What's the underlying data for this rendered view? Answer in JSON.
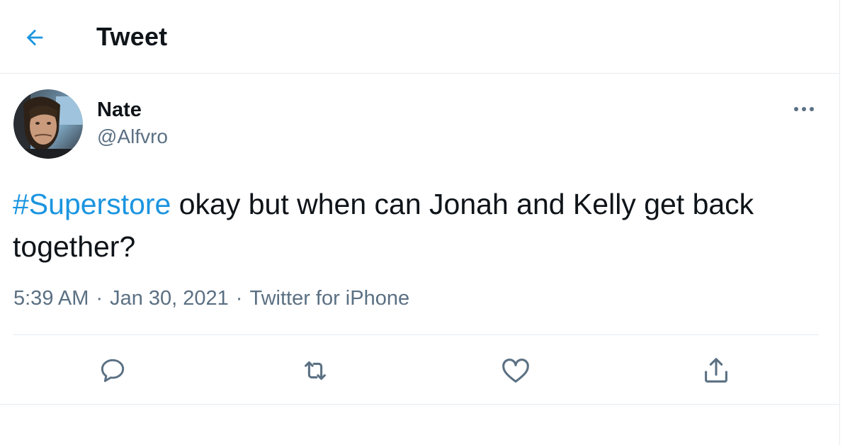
{
  "header": {
    "back_icon": "arrow-left-icon",
    "title": "Tweet",
    "accent_color": "#1b95e0"
  },
  "tweet": {
    "author": {
      "display_name": "Nate",
      "handle": "@Alfvro"
    },
    "more_icon": "more-horizontal-icon",
    "text": {
      "hashtag": "#Superstore",
      "body": " okay but when can Jonah and Kelly get back together?"
    },
    "meta": {
      "time": "5:39 AM",
      "separator": "·",
      "date": "Jan 30, 2021",
      "source": "Twitter for iPhone"
    },
    "actions": [
      {
        "icon": "reply-icon"
      },
      {
        "icon": "retweet-icon"
      },
      {
        "icon": "like-icon"
      },
      {
        "icon": "share-icon"
      }
    ]
  },
  "colors": {
    "text_primary": "#0f1419",
    "text_secondary": "#5b7083",
    "link": "#1b95e0",
    "border": "#e6ecf0"
  }
}
